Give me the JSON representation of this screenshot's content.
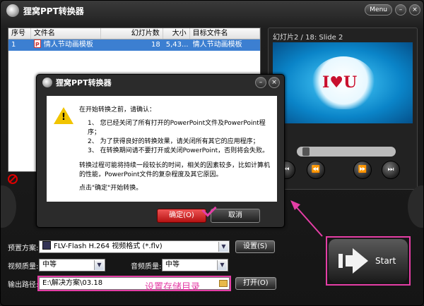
{
  "app": {
    "title": "狸窝PPT转换器",
    "menu_label": "Menu",
    "minimize": "–",
    "close": "×"
  },
  "table": {
    "headers": [
      "序号",
      "文件名",
      "幻灯片数",
      "大小",
      "目标文件名"
    ],
    "rows": [
      {
        "index": "1",
        "filename": "情人节动画模板",
        "slides": "18",
        "size": "5,43...",
        "target": "情人节动画模板"
      }
    ]
  },
  "preview": {
    "label": "幻灯片2 / 18: Slide 2",
    "slide_text": "I♥U",
    "controls": [
      "⏮",
      "⏪",
      "⏩",
      "⏭"
    ],
    "progress_fraction": 0.05
  },
  "settings": {
    "preset_label": "预置方案:",
    "preset_value": "FLV-Flash H.264 视频格式 (*.flv)",
    "preset_button": "设置(S)",
    "video_quality_label": "视频质量:",
    "video_quality_value": "中等",
    "audio_quality_label": "音频质量:",
    "audio_quality_value": "中等",
    "output_label": "输出路径:",
    "output_value": "E:\\解决方案\\03.18",
    "open_button": "打开(O)"
  },
  "start": {
    "label": "Start"
  },
  "annotation": {
    "text": "设置存储目录",
    "color": "#e53ea6"
  },
  "dialog": {
    "title": "狸窝PPT转换器",
    "intro": "在开始转换之前，请确认：",
    "items": [
      "1、 您已经关闭了所有打开的PowerPoint文件及PowerPoint程序；",
      "2、 为了获得良好的转换效果，请关闭所有其它的应用程序；",
      "3、 在转换期间请不要打开或关闭PowerPoint，否则将会失败。"
    ],
    "warning": "转换过程可能将持续一段较长的时间，相关的因素较多，比如计算机的性能，PowerPoint文件的复杂程度及其它原因。",
    "hint": "点击\"确定\"开始转换。",
    "ok_label": "确定(O)",
    "cancel_label": "取消"
  }
}
